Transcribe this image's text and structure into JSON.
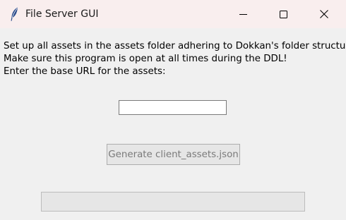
{
  "window": {
    "title": "File Server GUI",
    "icons": {
      "app": "feather-icon",
      "minimize": "minimize-icon",
      "maximize": "maximize-icon",
      "close": "close-icon"
    }
  },
  "main": {
    "instructions": [
      "Set up all assets in the assets folder adhering to Dokkan's folder structure.",
      "Make sure this program is open at all times during the DDL!",
      "Enter the base URL for the assets:"
    ],
    "base_url_input": {
      "value": "",
      "placeholder": ""
    },
    "generate_button_label": "Generate client_assets.json",
    "generate_button_state": "disabled",
    "progress": 0
  },
  "colors": {
    "titlebar_bg": "#f9eeee",
    "window_bg": "#f0f0f0",
    "disabled_text": "#7a7a7a"
  }
}
